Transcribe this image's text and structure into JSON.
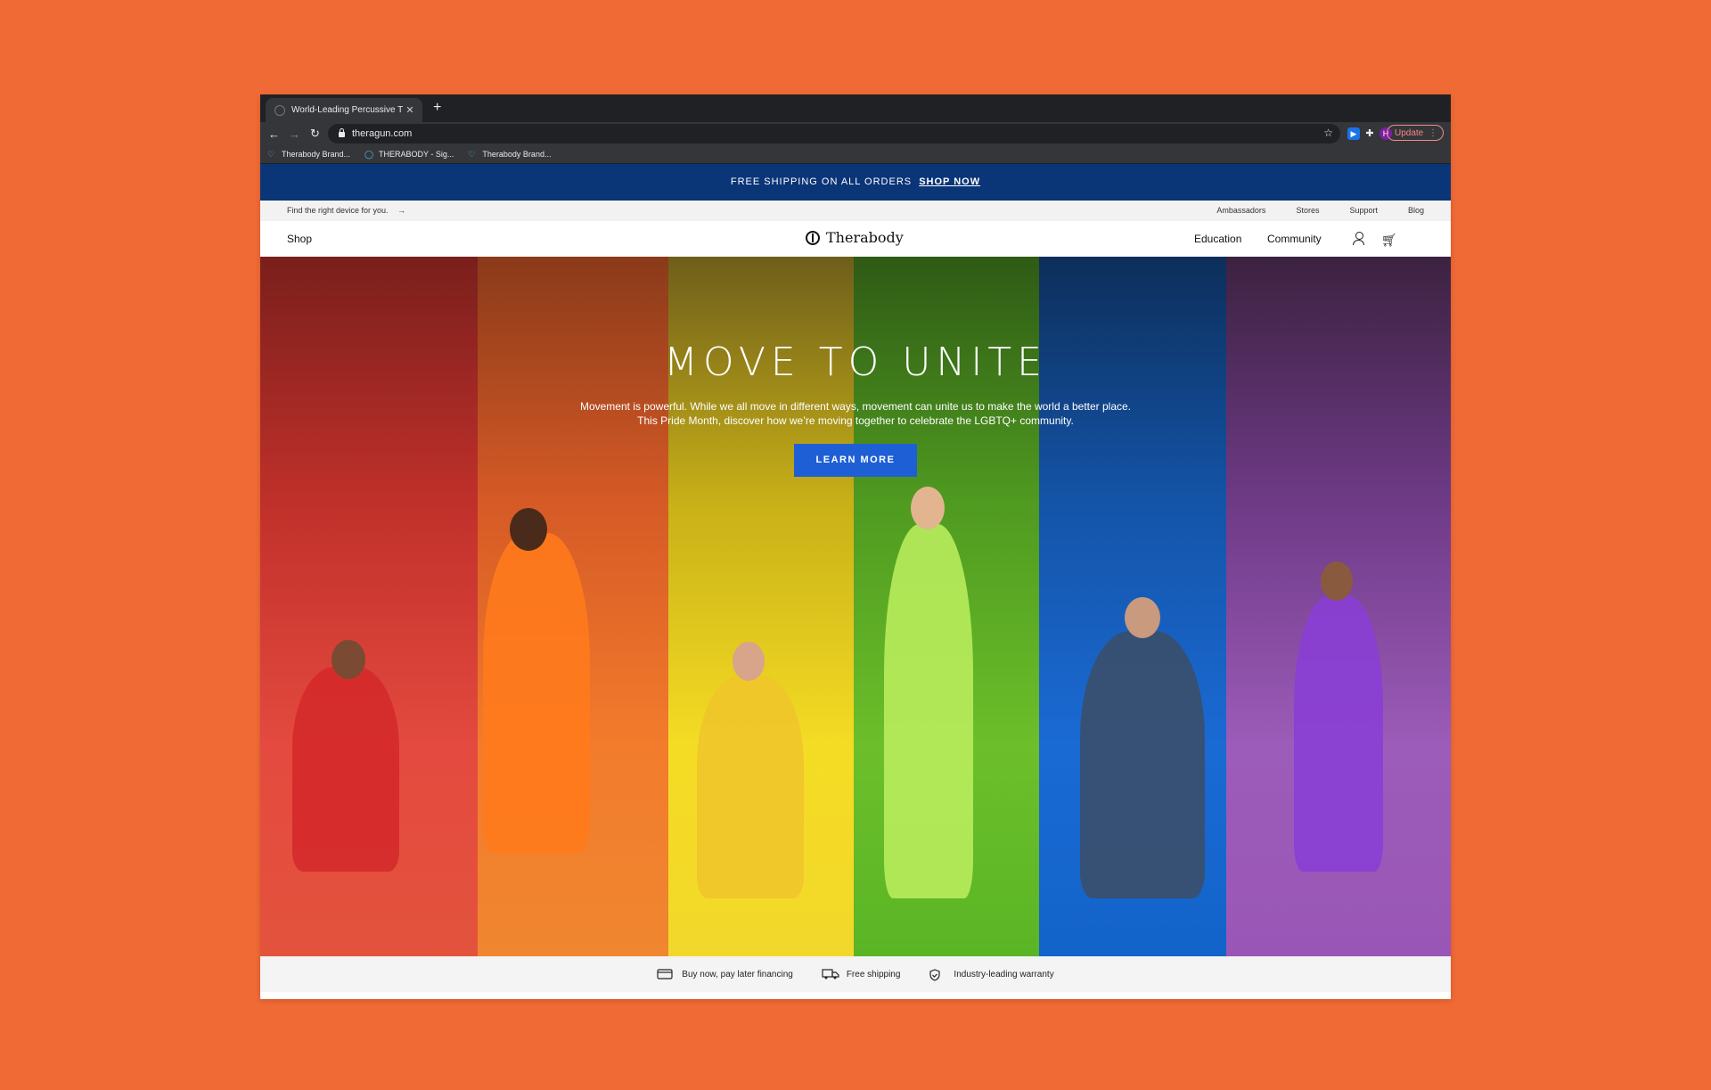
{
  "browser": {
    "tab_title": "World-Leading Percussive The",
    "tab_close": "✕",
    "new_tab": "+",
    "url": "theragun.com",
    "profile_initial": "H",
    "update_label": "Update",
    "bookmarks": [
      {
        "label": "Therabody Brand..."
      },
      {
        "label": "THERABODY - Sig..."
      },
      {
        "label": "Therabody Brand..."
      }
    ]
  },
  "promo": {
    "text": "FREE SHIPPING ON ALL ORDERS",
    "link": "SHOP NOW"
  },
  "utility": {
    "find_text": "Find the right device for you.",
    "find_arrow": "→",
    "links": [
      "Ambassadors",
      "Stores",
      "Support",
      "Blog"
    ]
  },
  "nav": {
    "shop": "Shop",
    "logo": "Therabody",
    "education": "Education",
    "community": "Community"
  },
  "hero": {
    "headline": "MOVE TO UNITE",
    "subtext": "Movement is powerful. While we all move in different ways, movement can unite us to make the world a better place. This Pride Month, discover how we’re moving together to celebrate the LGBTQ+ community.",
    "cta": "LEARN MORE"
  },
  "benefits": [
    {
      "icon": "credit-card-icon",
      "label": "Buy now, pay later financing"
    },
    {
      "icon": "truck-icon",
      "label": "Free shipping"
    },
    {
      "icon": "shield-icon",
      "label": "Industry-leading warranty"
    }
  ],
  "colors": {
    "background": "#F06A35",
    "promo_bar": "#0A3577",
    "cta": "#1f5fd6"
  }
}
